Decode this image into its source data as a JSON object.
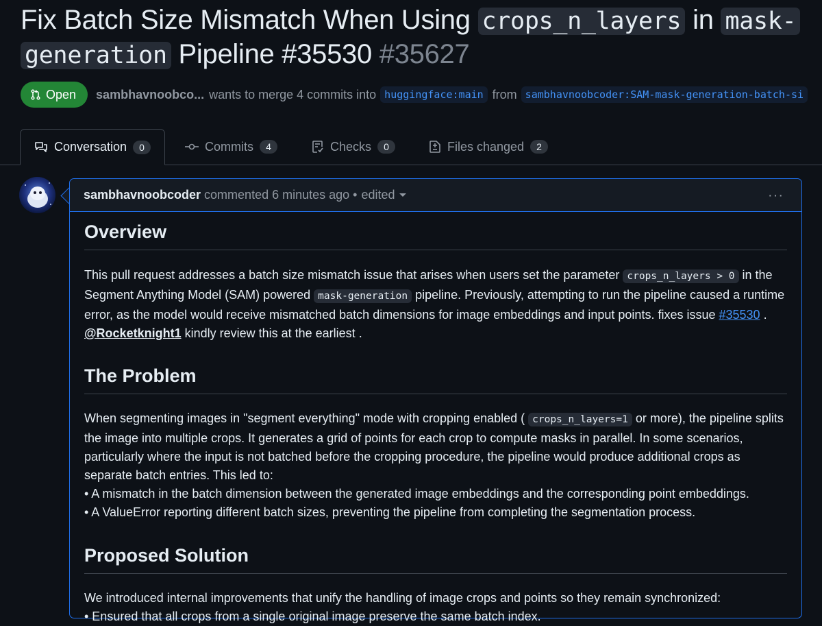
{
  "pr": {
    "title_part1": "Fix Batch Size Mismatch When Using ",
    "title_code1": "crops_n_layers",
    "title_part2": " in ",
    "title_code2a": "mask-",
    "title_code2b": "generation",
    "title_part3": " Pipeline #35530 ",
    "number": "#35627",
    "state": "Open",
    "author": "sambhavnoobco...",
    "merge_text": "wants to merge 4 commits into",
    "base_branch": "huggingface:main",
    "from_text": "from",
    "head_branch": "sambhavnoobcoder:SAM-mask-generation-batch-si"
  },
  "tabs": [
    {
      "label": "Conversation",
      "count": "0"
    },
    {
      "label": "Commits",
      "count": "4"
    },
    {
      "label": "Checks",
      "count": "0"
    },
    {
      "label": "Files changed",
      "count": "2"
    }
  ],
  "comment": {
    "author": "sambhavnoobcoder",
    "meta": "commented 6 minutes ago",
    "separator": "•",
    "edited": "edited",
    "menu": "···",
    "overview_heading": "Overview",
    "ov_a": "This pull request addresses a batch size mismatch issue that arises when users set the parameter ",
    "ov_code1": "crops_n_layers > 0",
    "ov_b": " in the Segment Anything Model (SAM) powered ",
    "ov_code2": "mask-generation",
    "ov_c": " pipeline. Previously, attempting to run the pipeline caused a runtime error, as the model would receive mismatched batch dimensions for image embeddings and input points. fixes issue ",
    "ov_link": "#35530",
    "ov_d": " . ",
    "ov_mention": "@Rocketknight1",
    "ov_e": " kindly review this at the earliest .",
    "problem_heading": "The Problem",
    "pr_a": "When segmenting images in \"segment everything\" mode with cropping enabled ( ",
    "pr_code": "crops_n_layers=1",
    "pr_b": " or more), the pipeline splits the image into multiple crops. It generates a grid of points for each crop to compute masks in parallel. In some scenarios, particularly where the input is not batched before the cropping procedure, the pipeline would produce additional crops as separate batch entries. This led to:",
    "pr_bullet1": "• A mismatch in the batch dimension between the generated image embeddings and the corresponding point embeddings.",
    "pr_bullet2": "• A ValueError reporting different batch sizes, preventing the pipeline from completing the segmentation process.",
    "solution_heading": "Proposed Solution",
    "sol_a": "We introduced internal improvements that unify the handling of image crops and points so they remain synchronized:",
    "sol_bullet1": "• Ensured that all crops from a single original image preserve the same batch index."
  },
  "colors": {
    "accent": "#1f6feb",
    "open": "#238636",
    "link": "#4493f8",
    "bg": "#0d1117"
  }
}
